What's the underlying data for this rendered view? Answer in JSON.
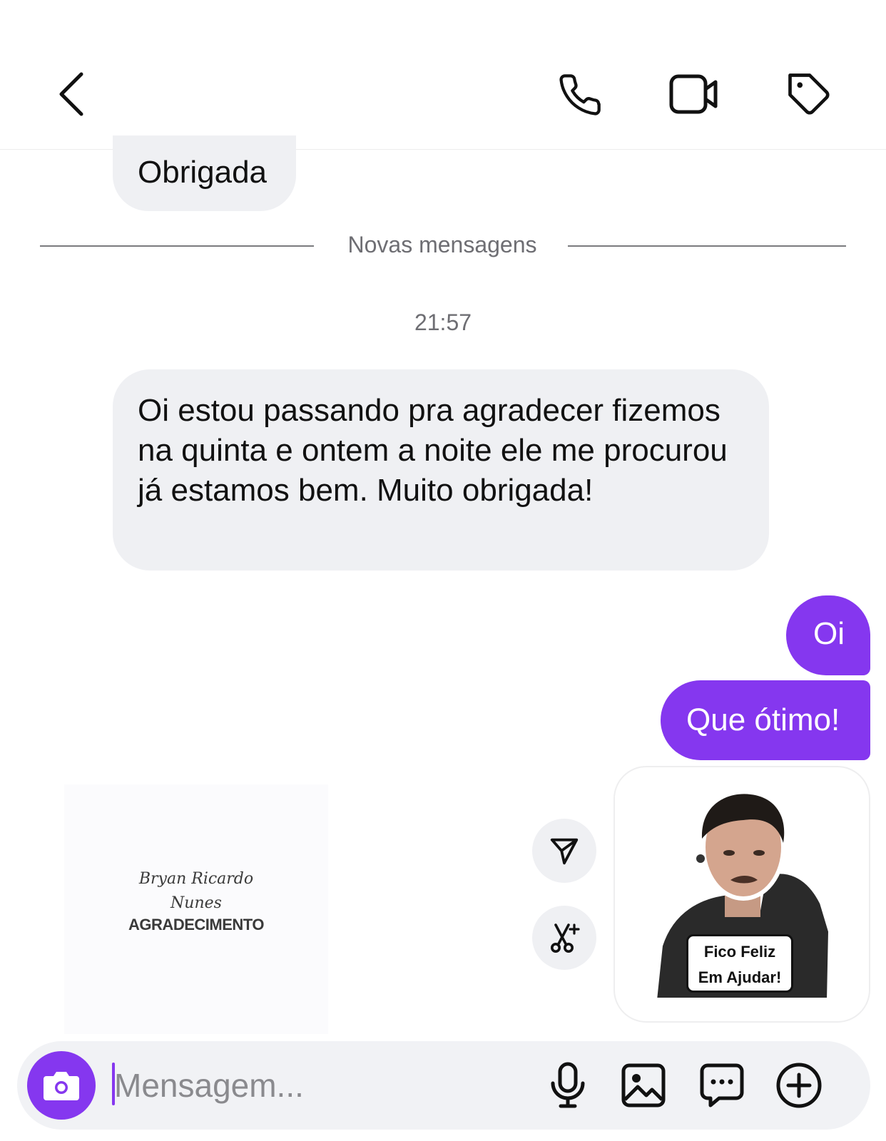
{
  "header": {
    "back_icon": "chevron-left-icon",
    "actions": [
      {
        "name": "call",
        "icon": "phone-icon"
      },
      {
        "name": "video",
        "icon": "video-camera-icon"
      },
      {
        "name": "tag",
        "icon": "tag-icon"
      }
    ]
  },
  "messages": {
    "received_1": "Obrigada",
    "divider_label": "Novas mensagens",
    "timestamp": "21:57",
    "received_2": "Oi estou passando pra agradecer fizemos na quinta e ontem a noite ele me procurou  já estamos bem. Muito obrigada!",
    "sent_1": "Oi",
    "sent_2": "Que ótimo!"
  },
  "sticker": {
    "line_1": "Fico Feliz",
    "line_2": "Em Ajudar!"
  },
  "watermark": {
    "name_line_1": "Bryan Ricardo",
    "name_line_2": "Nunes",
    "word": "AGRADECIMENTO"
  },
  "composer": {
    "placeholder": "Mensagem...",
    "value": ""
  },
  "colors": {
    "accent": "#8537ef",
    "incoming_bubble": "#eff0f3",
    "meta_text": "#6e6e73"
  }
}
